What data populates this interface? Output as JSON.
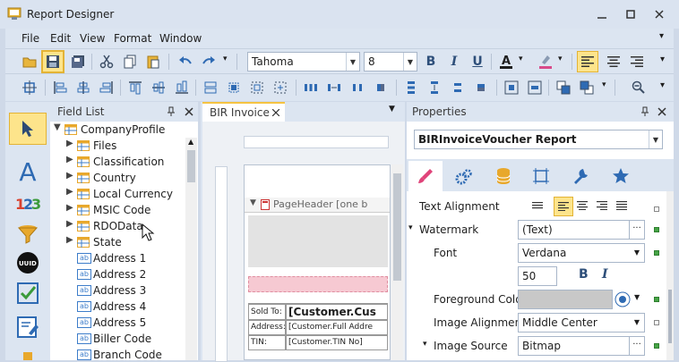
{
  "window": {
    "title": "Report Designer"
  },
  "menu": [
    "File",
    "Edit",
    "View",
    "Format",
    "Window"
  ],
  "toolbar": {
    "font_name": "Tahoma",
    "font_size": "8"
  },
  "field_list": {
    "title": "Field List",
    "root": "CompanyProfile",
    "groups": [
      "Files",
      "Classification",
      "Country",
      "Local Currency",
      "MSIC Code",
      "RDOData",
      "State"
    ],
    "fields": [
      "Address 1",
      "Address 2",
      "Address 3",
      "Address 4",
      "Address 5",
      "Biller Code",
      "Branch Code"
    ]
  },
  "designer": {
    "tab": "BIR Invoice",
    "band": "PageHeader [one b",
    "sold_to": "Sold To:",
    "customer_code": "[Customer.Cus",
    "address_label": "Address:",
    "address_value": "[Customer.Full Addre",
    "tin_label": "TIN:",
    "tin_value": "[Customer.TIN No]"
  },
  "properties": {
    "title": "Properties",
    "object": "BIRInvoiceVoucher  Report",
    "text_alignment": "Text Alignment",
    "watermark": "Watermark",
    "watermark_value": "(Text)",
    "font": "Font",
    "font_value": "Verdana",
    "font_size": "50",
    "bold": "B",
    "italic": "I",
    "foreground_color": "Foreground Color",
    "image_alignment": "Image Alignment",
    "image_alignment_value": "Middle Center",
    "image_source": "Image Source",
    "image_source_value": "Bitmap"
  }
}
